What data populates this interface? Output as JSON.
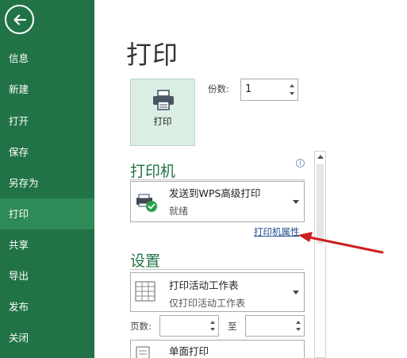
{
  "sidebar": {
    "items": [
      {
        "label": "信息"
      },
      {
        "label": "新建"
      },
      {
        "label": "打开"
      },
      {
        "label": "保存"
      },
      {
        "label": "另存为"
      },
      {
        "label": "打印"
      },
      {
        "label": "共享"
      },
      {
        "label": "导出"
      },
      {
        "label": "发布"
      },
      {
        "label": "关闭"
      }
    ],
    "active_index": 5
  },
  "page": {
    "title": "打印"
  },
  "print": {
    "button_label": "打印"
  },
  "copies": {
    "label": "份数:",
    "value": "1"
  },
  "printer": {
    "heading": "打印机",
    "name": "发送到WPS高级打印",
    "status": "就绪",
    "properties_link": "打印机属性",
    "info_icon": "i"
  },
  "settings": {
    "heading": "设置",
    "scope_main": "打印活动工作表",
    "scope_sub": "仅打印活动工作表",
    "pages_label": "页数:",
    "to_label": "至",
    "sides_main": "单面打印"
  },
  "colors": {
    "sidebar_bg": "#217346",
    "accent_green": "#217346",
    "annotation_arrow": "#cc1f1f"
  }
}
